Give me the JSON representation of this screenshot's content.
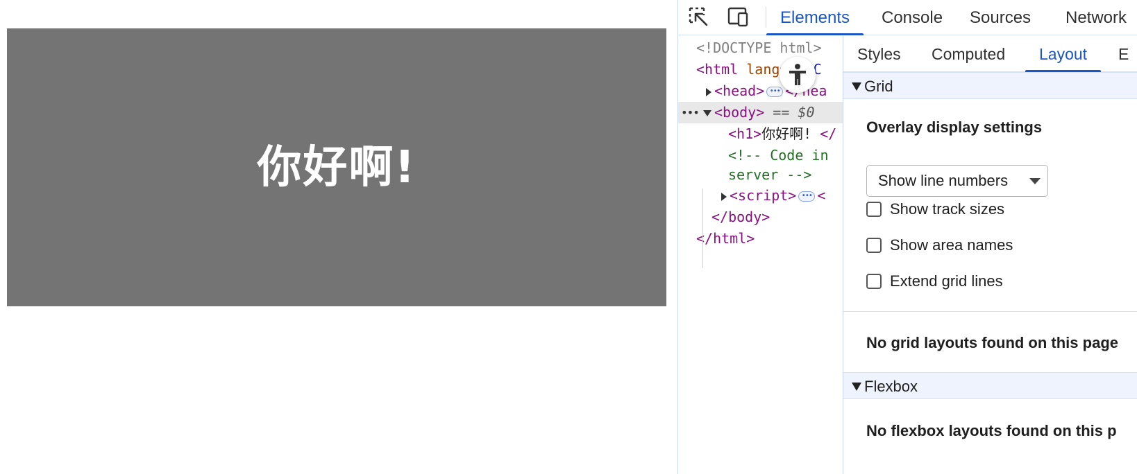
{
  "page": {
    "heading": "你好啊!"
  },
  "devtools": {
    "main_tabs": [
      {
        "label": "Elements",
        "active": true
      },
      {
        "label": "Console",
        "active": false
      },
      {
        "label": "Sources",
        "active": false
      },
      {
        "label": "Network",
        "active": false
      }
    ],
    "dom": {
      "doctype": "<!DOCTYPE html>",
      "html_open_tag": "<html",
      "html_attr_name": "lang",
      "html_attr_eq": "=",
      "html_attr_value": "zh-C",
      "head_open": "<head>",
      "head_close": "</hea",
      "body_open": "<body>",
      "body_eq": "== $0",
      "row_dots": "•••",
      "h1_open": "<h1>",
      "h1_text": "你好啊!",
      "h1_close": "</",
      "comment_line1": "<!-- Code in",
      "comment_line2": "server -->",
      "script_open": "<script>",
      "script_close": "<",
      "body_close": "</body>",
      "html_close": "</html>"
    },
    "side_tabs": [
      {
        "label": "Styles",
        "active": false
      },
      {
        "label": "Computed",
        "active": false
      },
      {
        "label": "Layout",
        "active": true
      },
      {
        "label": "E",
        "active": false
      }
    ],
    "layout": {
      "grid_section_title": "Grid",
      "overlay_title": "Overlay display settings",
      "line_select_value": "Show line numbers",
      "checkboxes": [
        {
          "label": "Show track sizes",
          "checked": false
        },
        {
          "label": "Show area names",
          "checked": false
        },
        {
          "label": "Extend grid lines",
          "checked": false
        }
      ],
      "no_grid_message": "No grid layouts found on this page",
      "flexbox_section_title": "Flexbox",
      "no_flexbox_message": "No flexbox layouts found on this p"
    }
  },
  "colors": {
    "accent": "#1a55c7",
    "page_block": "#747474"
  }
}
